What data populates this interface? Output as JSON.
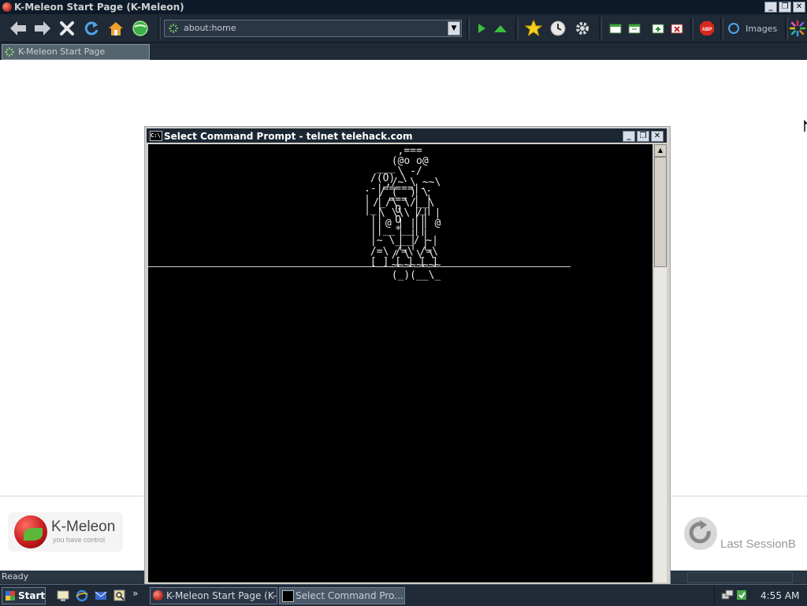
{
  "browser": {
    "window_title": "K-Meleon Start Page (K-Meleon)",
    "address": {
      "value": "about:home"
    },
    "images_label": "Images",
    "tab": {
      "label": "K-Meleon Start Page"
    },
    "status_text": "Ready"
  },
  "start_page": {
    "logo_name": "K-Meleon",
    "logo_tagline": "you have control",
    "last_session_label": "Last SessionB"
  },
  "terminal": {
    "title": "Select Command Prompt - telnet telehack.com",
    "icon_text": "C:\\",
    "ascii_art": "                    ,===\n                   (@o o@\n                    \\ -/\n                  ,/~ \\ ~~\\\n                 / (  ) \\\n                /_/\\ \\/__\\\n                 \\ \\\\\\ /| |\n                  @ | | | @\n                    | | |\n                    | | |\n                   / \\ \\ \\\n                   ~~~~~~~~\n                   (_)(__\\_",
    "r2d2_art": "             ___\n            /(O) \\\n           .-|=====|-.\n           | | === | |\n           |_|  O  |_|\n            ||  O  ||\n            ||__*__||\n            |~ \\___/ ~|\n            /=\\ /=\\ /=\\\n            [_]_[_]_[_]"
  },
  "taskbar": {
    "start_label": "Start",
    "tasks": [
      {
        "label": "K-Meleon Start Page (K-M..."
      },
      {
        "label": "Select Command Pro..."
      }
    ],
    "chevron": "»",
    "clock": "4:55 AM"
  },
  "colors": {
    "title_bar": "#0c1a29",
    "toolbar_bg": "#1f2a36",
    "terminal_bg": "#000000",
    "terminal_fg": "#e8e8e8"
  }
}
